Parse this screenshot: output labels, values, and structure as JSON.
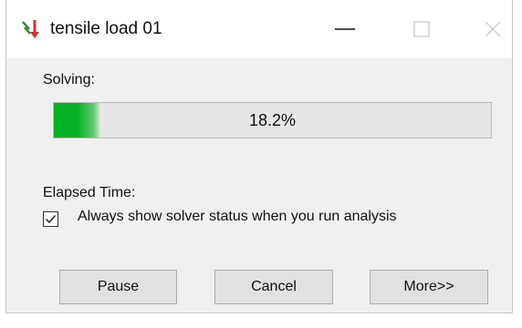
{
  "window": {
    "title": "tensile load 01",
    "icon": "tensile-load-app-icon"
  },
  "titlebar_buttons": {
    "minimize_icon": "minimize-icon",
    "maximize_icon": "maximize-icon",
    "close_icon": "close-icon"
  },
  "status": {
    "solving_label": "Solving:",
    "progress_text": "18.2%",
    "progress_fraction": 0.107,
    "elapsed_label": "Elapsed Time:"
  },
  "options": {
    "always_show_label": "Always show solver status when you run analysis",
    "always_show_checked": true
  },
  "buttons": {
    "pause": "Pause",
    "cancel": "Cancel",
    "more": "More>>"
  },
  "colors": {
    "progress_green": "#06b025",
    "window_bg": "#f0f0f0",
    "titlebar_bg": "#ffffff"
  }
}
